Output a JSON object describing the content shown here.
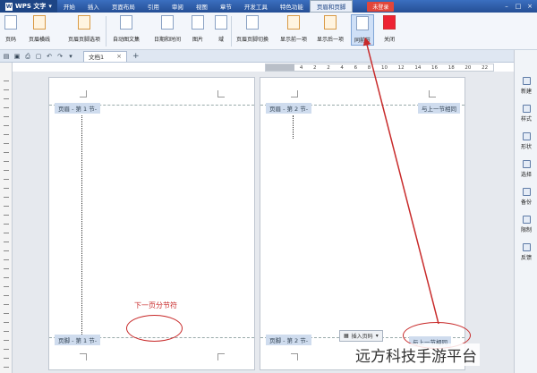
{
  "app": {
    "name": "WPS 文字"
  },
  "menu": {
    "items": [
      "开始",
      "插入",
      "页面布局",
      "引用",
      "审阅",
      "视图",
      "章节",
      "开发工具",
      "特色功能"
    ],
    "active_tab": "页眉和页脚",
    "login": "未登录"
  },
  "ribbon": {
    "buttons": {
      "page_number": "页码",
      "header_line": "页眉横线",
      "header_footer_options": "页眉页脚选项",
      "auto_text": "自动图文集",
      "date_time": "日期和时间",
      "picture": "图片",
      "field": "域",
      "switch_header_footer": "页眉页脚切换",
      "show_prev": "显示前一项",
      "show_next": "显示后一项",
      "same_as_previous": "同前节",
      "close": "关闭"
    }
  },
  "document": {
    "tab_title": "文档1"
  },
  "ruler": {
    "numbers": [
      "4",
      "2",
      "2",
      "4",
      "6",
      "8",
      "10",
      "12",
      "14",
      "16",
      "18",
      "20",
      "22"
    ]
  },
  "page1": {
    "header_label": "页眉 - 第 1 节-",
    "footer_label": "页脚 - 第 1 节-"
  },
  "page2": {
    "header_label": "页眉 - 第 2 节-",
    "header_link": "与上一节相同",
    "footer_label": "页脚 - 第 2 节-",
    "footer_link": "与上一节相同",
    "insert_page_number": "插入页码"
  },
  "annotation": {
    "section_break": "下一页分节符"
  },
  "sidebar": {
    "items": [
      "新建",
      "样式",
      "形状",
      "选择",
      "备份",
      "限制",
      "反馈"
    ]
  },
  "watermark": "远方科技手游平台",
  "colors": {
    "annotation_red": "#c82a2a",
    "title_blue": "#2b579a"
  }
}
